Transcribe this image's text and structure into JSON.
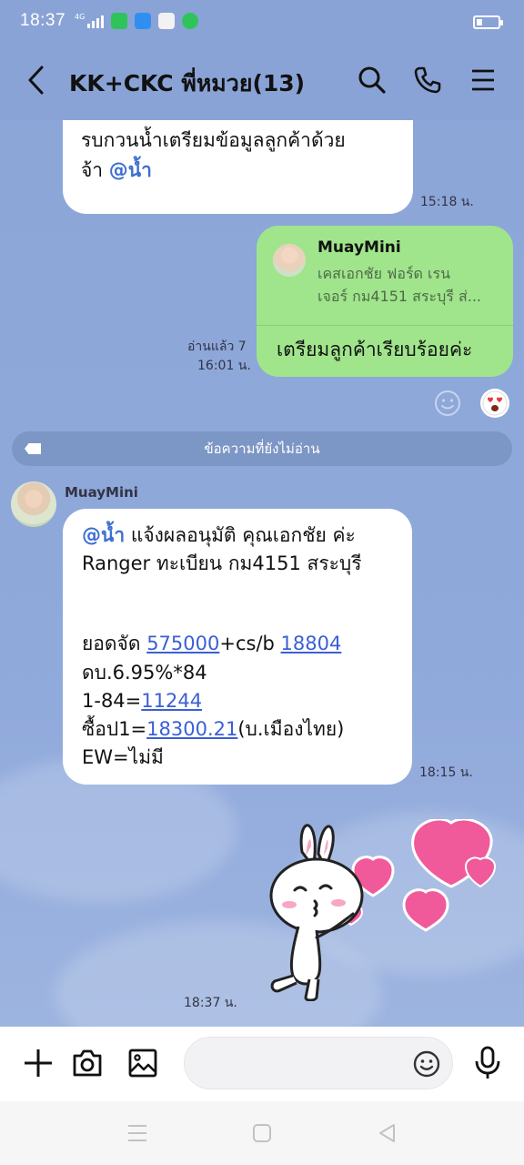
{
  "status_bar": {
    "time": "18:37",
    "network": "4G"
  },
  "header": {
    "title": "KK+CKC พี่หมวย(13)"
  },
  "colors": {
    "chat_bg": "#8ca6d8",
    "outgoing_bubble": "#a0e58c",
    "mention": "#3c6fd1",
    "link": "#3b5fd6"
  },
  "messages": {
    "first": {
      "line1": "รบกวนน้ำเตรียมข้อมูลลูกค้าด้วย",
      "line2_prefix": "จ้า ",
      "mention": "@น้ำ",
      "time": "15:18 น."
    },
    "reply": {
      "quoted_name": "MuayMini",
      "quoted_text_line1": "เคสเอกชัย ฟอร์ด เรน",
      "quoted_text_line2": "เจอร์ กม4151 สระบุรี ส่...",
      "text": "เตรียมลูกค้าเรียบร้อยค่ะ",
      "read_status": "อ่านแล้ว 7",
      "time": "16:01 น."
    },
    "unread_divider": "ข้อความที่ยังไม่อ่าน",
    "incoming": {
      "sender": "MuayMini",
      "mention": "@น้ำ",
      "line1_rest": " แจ้งผลอนุมัติ คุณเอกชัย ค่ะ",
      "line2": "Ranger ทะเบียน กม4151 สระบุรี",
      "line3_prefix": "ยอดจัด ",
      "line3_num1": "575000",
      "line3_mid": "+cs/b ",
      "line3_num2": "18804",
      "line4": "ดบ.6.95%*84",
      "line5_prefix": "1-84=",
      "line5_num": "11244",
      "line6_prefix": "ซื้อป1=",
      "line6_num": "18300.21",
      "line6_suffix": "(บ.เมืองไทย)",
      "line7": "EW=ไม่มี",
      "time": "18:15 น."
    },
    "sticker": {
      "icon": "cony-hearts-sticker",
      "time": "18:37 น."
    }
  },
  "input": {
    "placeholder": ""
  }
}
